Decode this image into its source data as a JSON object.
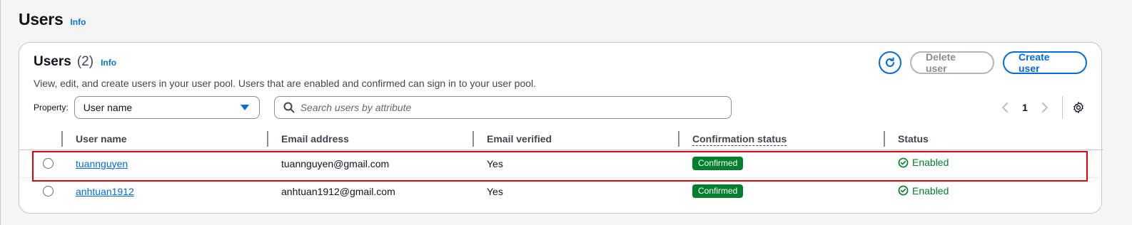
{
  "page": {
    "title": "Users",
    "info_label": "Info"
  },
  "container": {
    "title": "Users",
    "count": "(2)",
    "info_label": "Info",
    "description": "View, edit, and create users in your user pool. Users that are enabled and confirmed can sign in to your user pool.",
    "refresh_icon": "refresh-icon",
    "delete_label": "Delete user",
    "create_label": "Create user"
  },
  "filter": {
    "property_label": "Property:",
    "property_value": "User name",
    "search_placeholder": "Search users by attribute"
  },
  "pagination": {
    "current_page": "1"
  },
  "table": {
    "columns": [
      "User name",
      "Email address",
      "Email verified",
      "Confirmation status",
      "Status"
    ],
    "rows": [
      {
        "user_name": "tuannguyen",
        "email": "tuannguyen@gmail.com",
        "email_verified": "Yes",
        "confirmation_status": "Confirmed",
        "status": "Enabled"
      },
      {
        "user_name": "anhtuan1912",
        "email": "anhtuan1912@gmail.com",
        "email_verified": "Yes",
        "confirmation_status": "Confirmed",
        "status": "Enabled"
      }
    ]
  },
  "colors": {
    "accent": "#006ce0",
    "success": "#00802f",
    "highlight": "#e8000b"
  }
}
